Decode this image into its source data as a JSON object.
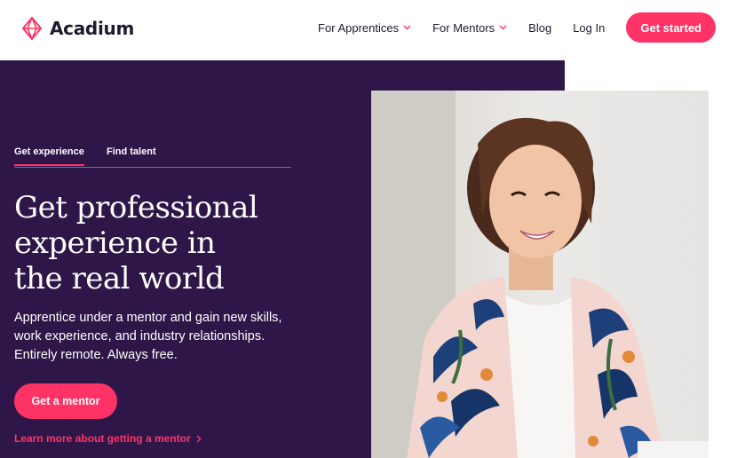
{
  "brand": {
    "name": "Acadium",
    "accent_color": "#ff3366",
    "hero_color": "#2e1748"
  },
  "nav": {
    "items": [
      {
        "label": "For Apprentices",
        "has_dropdown": true
      },
      {
        "label": "For Mentors",
        "has_dropdown": true
      },
      {
        "label": "Blog",
        "has_dropdown": false
      },
      {
        "label": "Log In",
        "has_dropdown": false
      }
    ],
    "cta_label": "Get started"
  },
  "hero": {
    "tabs": [
      {
        "label": "Get experience",
        "active": true
      },
      {
        "label": "Find talent",
        "active": false
      }
    ],
    "headline_lines": [
      "Get professional",
      "experience in",
      "the real world"
    ],
    "subtext_lines": [
      "Apprentice under a mentor and gain new skills,",
      "work experience, and industry relationships.",
      "Entirely remote. Always free."
    ],
    "cta_label": "Get a mentor",
    "link_label": "Learn more about getting a mentor"
  },
  "icons": {
    "logo": "acadium-diamond-logo-icon",
    "dropdown": "chevron-down-icon",
    "link_arrow": "chevron-right-icon"
  }
}
